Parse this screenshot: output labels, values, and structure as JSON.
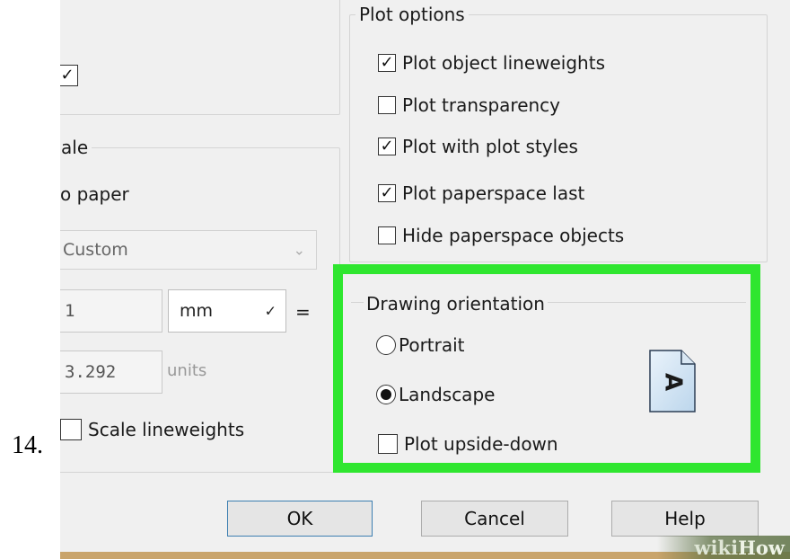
{
  "step_number": "14.",
  "left_panel": {
    "top_checkbox_checked": true,
    "scale_group_legend": "ale",
    "fit_to_paper_label": "o paper",
    "scale_combo_value": "Custom",
    "scale_value_1": "1",
    "scale_unit": "mm",
    "equals": "=",
    "scale_value_2": "3.292",
    "units_label": "units",
    "scale_lineweights": {
      "label": "Scale lineweights",
      "checked": false
    }
  },
  "plot_options": {
    "legend": "Plot options",
    "items": [
      {
        "label": "Plot object lineweights",
        "checked": true
      },
      {
        "label": "Plot transparency",
        "checked": false
      },
      {
        "label": "Plot with plot styles",
        "checked": true
      },
      {
        "label": "Plot paperspace last",
        "checked": true
      },
      {
        "label": "Hide paperspace objects",
        "checked": false
      }
    ]
  },
  "drawing_orientation": {
    "legend": "Drawing orientation",
    "options": [
      {
        "label": "Portrait",
        "selected": false
      },
      {
        "label": "Landscape",
        "selected": true
      }
    ],
    "upside_down": {
      "label": "Plot upside-down",
      "checked": false
    },
    "preview_letter": "A",
    "highlight_color": "#2fe62f"
  },
  "buttons": {
    "ok": "OK",
    "cancel": "Cancel",
    "help": "Help"
  },
  "watermark": {
    "wiki": "wiki",
    "how": "How"
  }
}
